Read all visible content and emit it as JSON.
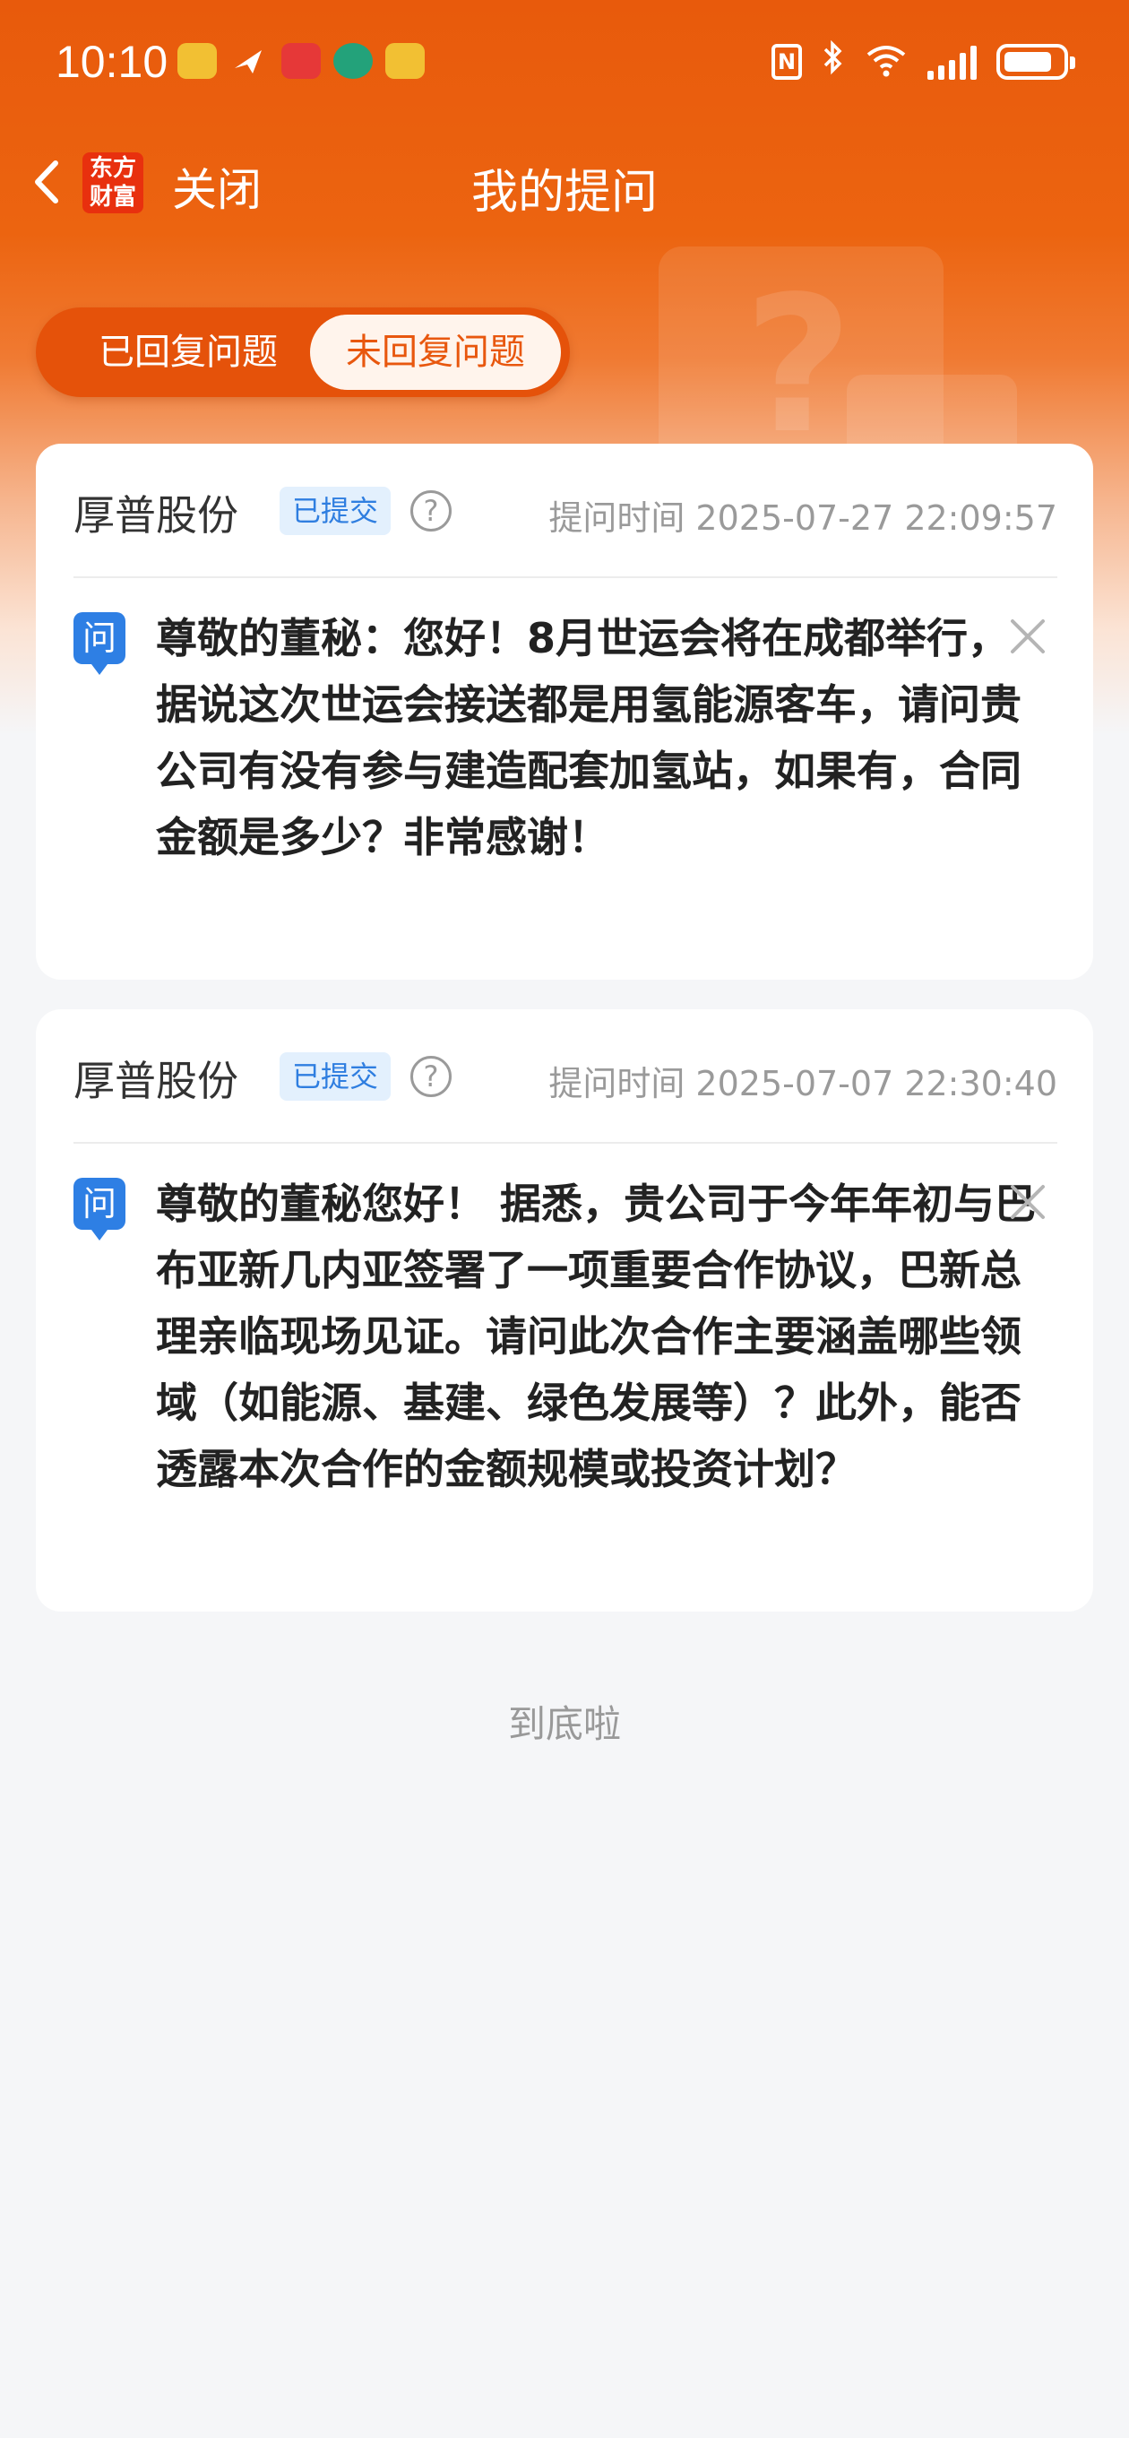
{
  "status_bar": {
    "time": "10:10"
  },
  "nav": {
    "logo_text": "东方财富",
    "close_label": "关闭",
    "title": "我的提问"
  },
  "tabs": [
    {
      "label": "已回复问题",
      "active": false
    },
    {
      "label": "未回复问题",
      "active": true
    }
  ],
  "questions": [
    {
      "company": "厚普股份",
      "status": "已提交",
      "time": "提问时间 2025-07-27 22:09:57",
      "q_icon": "问",
      "text": "尊敬的董秘：您好！8月世运会将在成都举行，据说这次世运会接送都是用氢能源客车，请问贵公司有没有参与建造配套加氢站，如果有，合同金额是多少？非常感谢！"
    },
    {
      "company": "厚普股份",
      "status": "已提交",
      "time": "提问时间 2025-07-07 22:30:40",
      "q_icon": "问",
      "text": "尊敬的董秘您好！ 据悉，贵公司于今年年初与巴布亚新几内亚签署了一项重要合作协议，巴新总理亲临现场见证。请问此次合作主要涵盖哪些领域（如能源、基建、绿色发展等）？此外，能否透露本次合作的金额规模或投资计划？"
    }
  ],
  "footer": {
    "end_text": "到底啦"
  },
  "colors": {
    "brand_orange": "#e85a0c",
    "accent_blue": "#2e7fe4"
  }
}
